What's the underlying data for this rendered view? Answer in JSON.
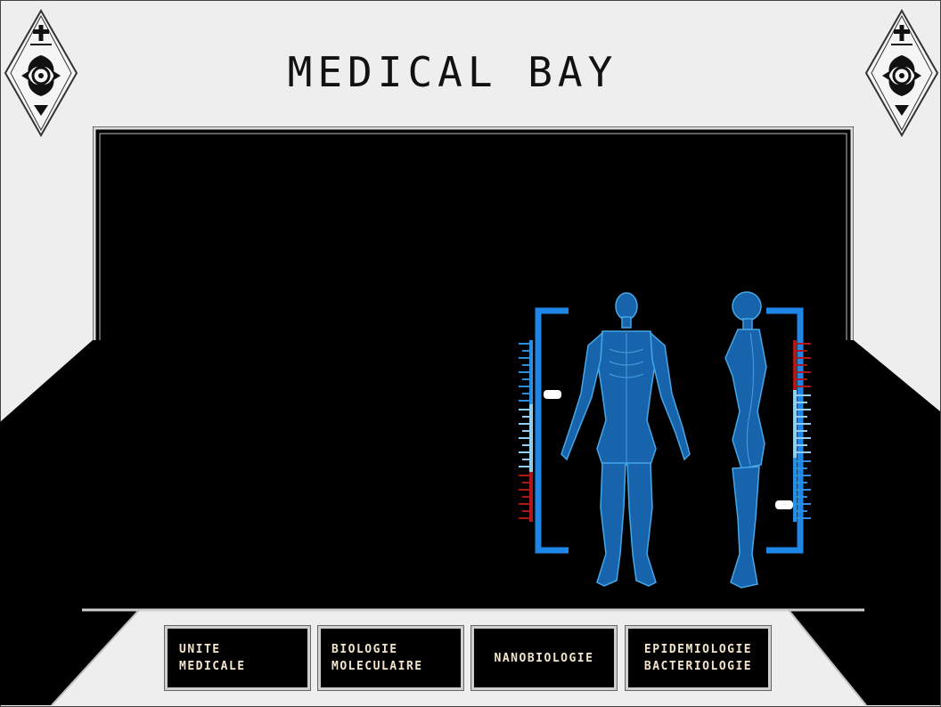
{
  "screen": {
    "title": "MEDICAL BAY"
  },
  "emblems": {
    "left": "insignia-emblem",
    "right": "insignia-emblem"
  },
  "viewer": {
    "subject": "hologram-body-scan"
  },
  "nav": [
    {
      "line1": "UNITE",
      "line2": "MEDICALE"
    },
    {
      "line1": "BIOLOGIE",
      "line2": "MOLECULAIRE"
    },
    {
      "line1": "NANOBIOLOGIE"
    },
    {
      "line1": "EPIDEMIOLOGIE",
      "line2": "BACTERIOLOGIE"
    }
  ],
  "colors": {
    "background": "#eeeeee",
    "panel": "#000000",
    "hologram": "#2f8fe0",
    "alert": "#b01818",
    "button_text": "#f2e4cd"
  }
}
